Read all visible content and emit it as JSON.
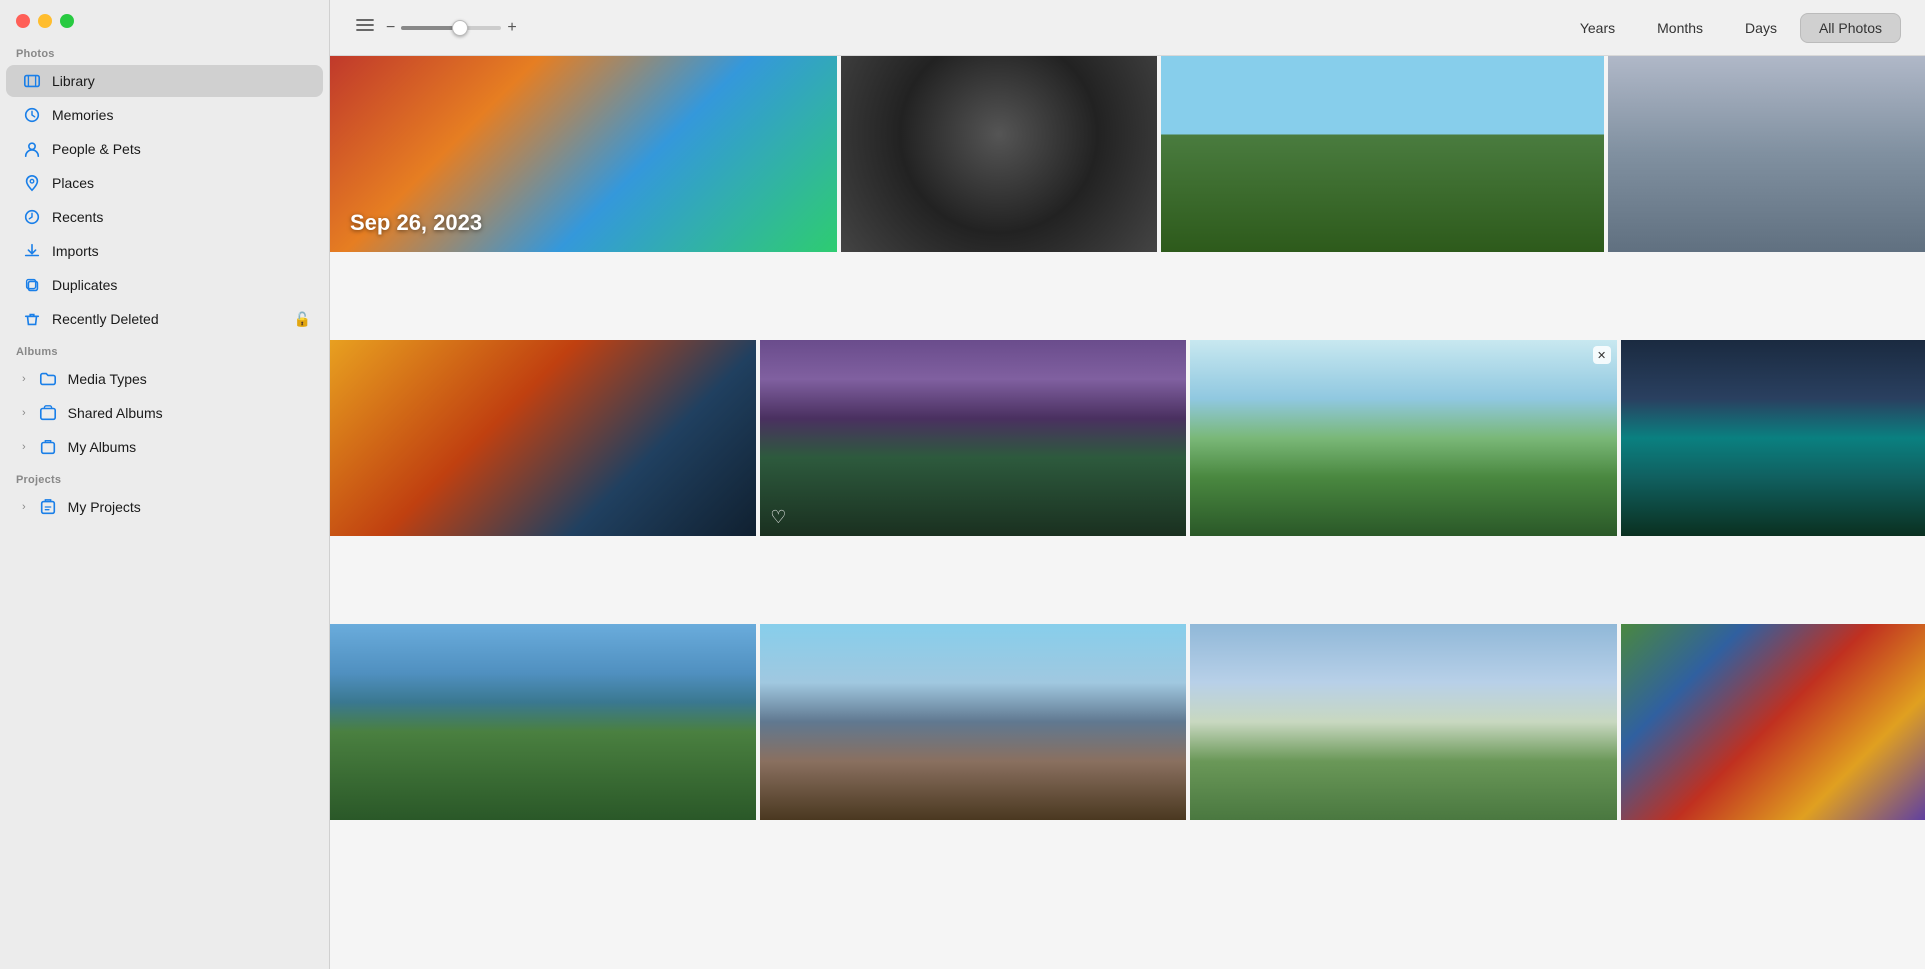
{
  "window": {
    "title": "Photos"
  },
  "window_controls": {
    "close": "close",
    "minimize": "minimize",
    "maximize": "maximize"
  },
  "sidebar": {
    "sections": [
      {
        "label": "Photos",
        "items": [
          {
            "id": "library",
            "label": "Library",
            "icon": "library-icon",
            "active": true
          },
          {
            "id": "memories",
            "label": "Memories",
            "icon": "memories-icon",
            "active": false
          },
          {
            "id": "people-pets",
            "label": "People & Pets",
            "icon": "people-icon",
            "active": false
          },
          {
            "id": "places",
            "label": "Places",
            "icon": "places-icon",
            "active": false
          },
          {
            "id": "recents",
            "label": "Recents",
            "icon": "recents-icon",
            "active": false
          },
          {
            "id": "imports",
            "label": "Imports",
            "icon": "imports-icon",
            "active": false
          },
          {
            "id": "duplicates",
            "label": "Duplicates",
            "icon": "duplicates-icon",
            "active": false
          },
          {
            "id": "recently-deleted",
            "label": "Recently Deleted",
            "icon": "trash-icon",
            "active": false,
            "lock": true
          }
        ]
      },
      {
        "label": "Albums",
        "items": [
          {
            "id": "media-types",
            "label": "Media Types",
            "icon": "folder-icon",
            "active": false,
            "chevron": true
          },
          {
            "id": "shared-albums",
            "label": "Shared Albums",
            "icon": "shared-icon",
            "active": false,
            "chevron": true
          },
          {
            "id": "my-albums",
            "label": "My Albums",
            "icon": "album-icon",
            "active": false,
            "chevron": true
          }
        ]
      },
      {
        "label": "Projects",
        "items": [
          {
            "id": "my-projects",
            "label": "My Projects",
            "icon": "projects-icon",
            "active": false,
            "chevron": true
          }
        ]
      }
    ]
  },
  "toolbar": {
    "zoom_minus": "−",
    "zoom_plus": "+",
    "zoom_value": 60,
    "view_tabs": [
      {
        "id": "years",
        "label": "Years",
        "active": false
      },
      {
        "id": "months",
        "label": "Months",
        "active": false
      },
      {
        "id": "days",
        "label": "Days",
        "active": false
      },
      {
        "id": "all-photos",
        "label": "All Photos",
        "active": true
      }
    ]
  },
  "photo_grid": {
    "sections": [
      {
        "date": "Sep 26, 2023",
        "rows": [
          {
            "photos": [
              {
                "id": "p1",
                "style": "photo-autumn",
                "has_date": true,
                "date": "Sep 26, 2023"
              },
              {
                "id": "p2",
                "style": "photo-circular"
              },
              {
                "id": "p3",
                "style": "photo-green-field"
              },
              {
                "id": "p4",
                "style": "photo-misty"
              }
            ]
          }
        ]
      },
      {
        "date": "",
        "rows": [
          {
            "photos": [
              {
                "id": "p5",
                "style": "photo-collage"
              },
              {
                "id": "p6",
                "style": "photo-mountain-lake",
                "has_heart": true
              },
              {
                "id": "p7",
                "style": "photo-landscape-tree",
                "has_badge": true
              },
              {
                "id": "p8",
                "style": "photo-dark-tree"
              }
            ]
          }
        ]
      },
      {
        "date": "",
        "rows": [
          {
            "photos": [
              {
                "id": "p9",
                "style": "photo-lake-forest"
              },
              {
                "id": "p10",
                "style": "photo-mountain-moraine"
              },
              {
                "id": "p11",
                "style": "photo-road-field"
              },
              {
                "id": "p12",
                "style": "photo-collage2"
              }
            ]
          }
        ]
      }
    ]
  }
}
